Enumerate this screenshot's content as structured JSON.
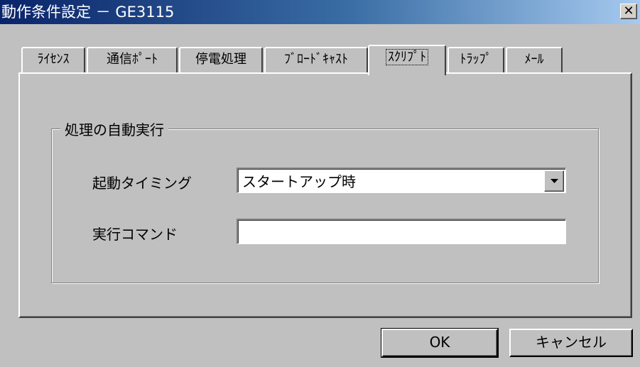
{
  "window": {
    "title": "動作条件設定 － GE3115",
    "close_glyph": "✕"
  },
  "tabs": [
    {
      "label": "ﾗｲｾﾝｽ"
    },
    {
      "label": "通信ﾎﾟｰﾄ"
    },
    {
      "label": "停電処理"
    },
    {
      "label": "ﾌﾞﾛｰﾄﾞｷｬｽﾄ"
    },
    {
      "label": "ｽｸﾘﾌﾟﾄ",
      "active": true
    },
    {
      "label": "ﾄﾗｯﾌﾟ"
    },
    {
      "label": "ﾒｰﾙ"
    }
  ],
  "group": {
    "title": "処理の自動実行"
  },
  "fields": {
    "start_timing_label": "起動タイミング",
    "start_timing_value": "スタートアップ時",
    "command_label": "実行コマンド",
    "command_value": ""
  },
  "buttons": {
    "ok": "OK",
    "cancel": "キャンセル"
  },
  "colors": {
    "titlebar_start": "#0a246a",
    "titlebar_end": "#a6caf0",
    "face": "#c0c0c0"
  }
}
